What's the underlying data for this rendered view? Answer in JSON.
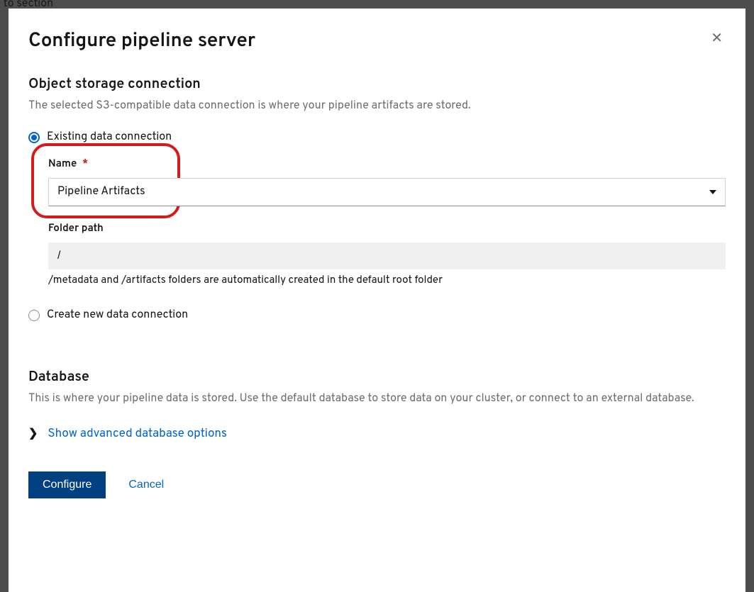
{
  "backdrop": {
    "text_fragment": "p to section"
  },
  "modal": {
    "title": "Configure pipeline server",
    "object_storage": {
      "heading": "Object storage connection",
      "description": "The selected S3-compatible data connection is where your pipeline artifacts are stored.",
      "radios": {
        "existing_label": "Existing data connection",
        "create_new_label": "Create new data connection",
        "selected": "existing"
      },
      "name_field": {
        "label": "Name",
        "required_marker": "*",
        "value": "Pipeline Artifacts"
      },
      "folder_field": {
        "label": "Folder path",
        "value": "/",
        "helper": "/metadata and /artifacts folders are automatically created in the default root folder"
      }
    },
    "database": {
      "heading": "Database",
      "description": "This is where your pipeline data is stored. Use the default database to store data on your cluster, or connect to an external database.",
      "expand_label": "Show advanced database options"
    },
    "footer": {
      "configure_label": "Configure",
      "cancel_label": "Cancel"
    }
  }
}
